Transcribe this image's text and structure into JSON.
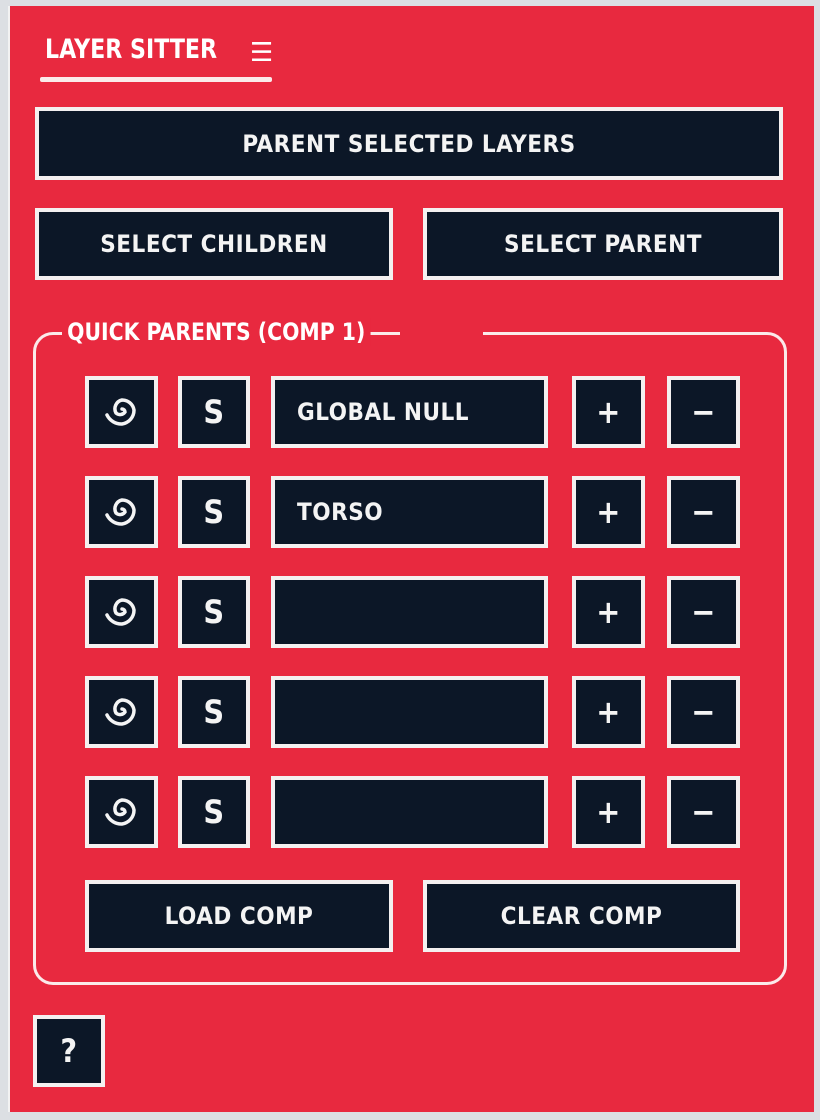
{
  "header": {
    "title": "LAYER SITTER",
    "menu_icon": "hamburger-icon"
  },
  "actions": {
    "parent_selected": "PARENT SELECTED LAYERS",
    "select_children": "SELECT CHILDREN",
    "select_parent": "SELECT PARENT"
  },
  "quick_parents": {
    "legend": "QUICK PARENTS (COMP 1)",
    "rows": [
      {
        "swirl_icon": "swirl-icon",
        "s_label": "S",
        "name": "GLOBAL NULL",
        "plus": "+",
        "minus": "−"
      },
      {
        "swirl_icon": "swirl-icon",
        "s_label": "S",
        "name": "TORSO",
        "plus": "+",
        "minus": "−"
      },
      {
        "swirl_icon": "swirl-icon",
        "s_label": "S",
        "name": "",
        "plus": "+",
        "minus": "−"
      },
      {
        "swirl_icon": "swirl-icon",
        "s_label": "S",
        "name": "",
        "plus": "+",
        "minus": "−"
      },
      {
        "swirl_icon": "swirl-icon",
        "s_label": "S",
        "name": "",
        "plus": "+",
        "minus": "−"
      }
    ],
    "load_comp": "LOAD COMP",
    "clear_comp": "CLEAR COMP"
  },
  "help": {
    "label": "?"
  },
  "colors": {
    "background": "#e8293f",
    "button": "#0c1727",
    "border": "#f4f0f0"
  }
}
